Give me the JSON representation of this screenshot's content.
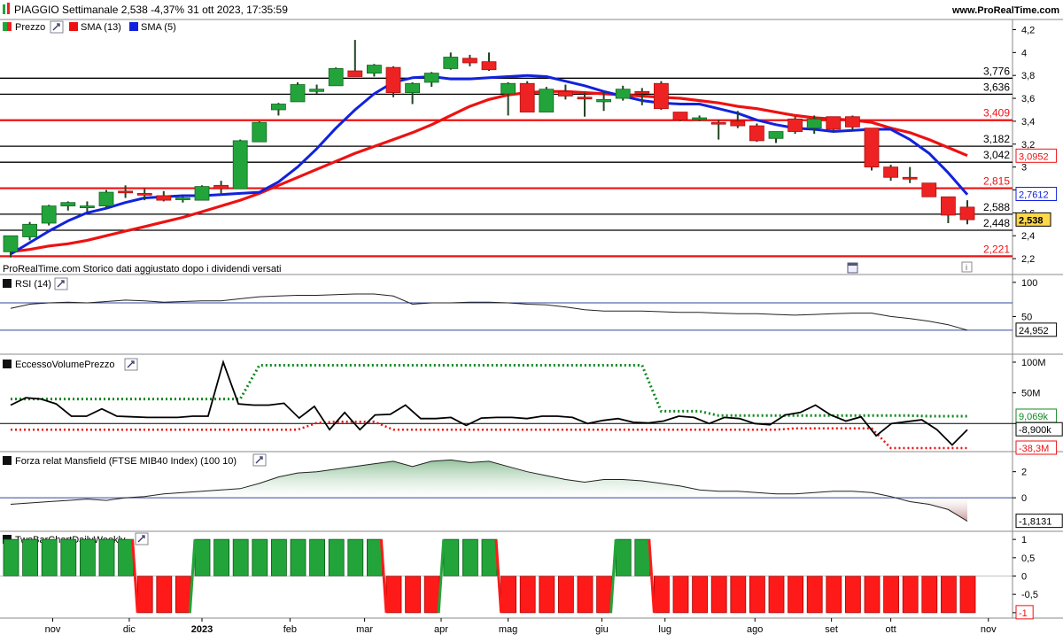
{
  "header": {
    "title": "PIAGGIO Settimanale 2,538 -4,37% 31 ott 2023, 17:35:59",
    "site": "www.ProRealTime.com"
  },
  "panels": {
    "price": {
      "legend": [
        "Prezzo",
        "SMA (13)",
        "SMA (5)"
      ],
      "footer": "ProRealTime.com Storico dati aggiustato dopo i dividendi versati"
    },
    "rsi": {
      "title": "RSI (14)"
    },
    "volume": {
      "title": "EccessoVolumePrezzo"
    },
    "mansfield": {
      "title": "Forza relat Mansfield (FTSE MIB40 Index) (100 10)"
    },
    "twobar": {
      "title": "TwoBarChartDailyWeekly"
    }
  },
  "colors": {
    "up": "#22a43a",
    "down": "#ee2222",
    "sma13": "#ee1111",
    "sma5": "#1122dd",
    "grid": "#000000",
    "green_dotted": "#118822",
    "red_dotted": "#ee1111"
  },
  "chart_data": [
    {
      "type": "candlestick",
      "name": "Prezzo",
      "y_ticks": [
        "4,2",
        "4",
        "3,8",
        "3,6",
        "3,4",
        "3,2",
        "3",
        "2,8",
        "2,6",
        "2,4",
        "2,2"
      ],
      "ylim": [
        2.1,
        4.25
      ],
      "x_labels": [
        "nov",
        "dic",
        "2023",
        "feb",
        "mar",
        "apr",
        "mag",
        "giu",
        "lug",
        "ago",
        "set",
        "ott",
        "nov"
      ],
      "candles": [
        {
          "o": 2.26,
          "h": 2.4,
          "l": 2.21,
          "c": 2.4
        },
        {
          "o": 2.39,
          "h": 2.52,
          "l": 2.36,
          "c": 2.5
        },
        {
          "o": 2.51,
          "h": 2.67,
          "l": 2.49,
          "c": 2.66
        },
        {
          "o": 2.66,
          "h": 2.7,
          "l": 2.62,
          "c": 2.69
        },
        {
          "o": 2.65,
          "h": 2.7,
          "l": 2.61,
          "c": 2.66
        },
        {
          "o": 2.66,
          "h": 2.8,
          "l": 2.64,
          "c": 2.78
        },
        {
          "o": 2.79,
          "h": 2.84,
          "l": 2.73,
          "c": 2.78
        },
        {
          "o": 2.77,
          "h": 2.81,
          "l": 2.71,
          "c": 2.76
        },
        {
          "o": 2.75,
          "h": 2.79,
          "l": 2.7,
          "c": 2.71
        },
        {
          "o": 2.72,
          "h": 2.74,
          "l": 2.69,
          "c": 2.73
        },
        {
          "o": 2.71,
          "h": 2.84,
          "l": 2.71,
          "c": 2.83
        },
        {
          "o": 2.84,
          "h": 2.88,
          "l": 2.77,
          "c": 2.81
        },
        {
          "o": 2.81,
          "h": 3.24,
          "l": 2.81,
          "c": 3.23
        },
        {
          "o": 3.22,
          "h": 3.4,
          "l": 3.22,
          "c": 3.39
        },
        {
          "o": 3.5,
          "h": 3.56,
          "l": 3.45,
          "c": 3.55
        },
        {
          "o": 3.57,
          "h": 3.74,
          "l": 3.57,
          "c": 3.72
        },
        {
          "o": 3.66,
          "h": 3.72,
          "l": 3.64,
          "c": 3.68
        },
        {
          "o": 3.71,
          "h": 3.87,
          "l": 3.71,
          "c": 3.86
        },
        {
          "o": 3.84,
          "h": 4.11,
          "l": 3.79,
          "c": 3.79
        },
        {
          "o": 3.82,
          "h": 3.9,
          "l": 3.79,
          "c": 3.89
        },
        {
          "o": 3.87,
          "h": 3.88,
          "l": 3.61,
          "c": 3.65
        },
        {
          "o": 3.65,
          "h": 3.74,
          "l": 3.55,
          "c": 3.73
        },
        {
          "o": 3.74,
          "h": 3.83,
          "l": 3.7,
          "c": 3.82
        },
        {
          "o": 3.86,
          "h": 4.0,
          "l": 3.85,
          "c": 3.96
        },
        {
          "o": 3.95,
          "h": 3.98,
          "l": 3.88,
          "c": 3.91
        },
        {
          "o": 3.92,
          "h": 4.0,
          "l": 3.84,
          "c": 3.85
        },
        {
          "o": 3.64,
          "h": 3.74,
          "l": 3.45,
          "c": 3.73
        },
        {
          "o": 3.73,
          "h": 3.75,
          "l": 3.48,
          "c": 3.48
        },
        {
          "o": 3.48,
          "h": 3.7,
          "l": 3.48,
          "c": 3.68
        },
        {
          "o": 3.66,
          "h": 3.72,
          "l": 3.59,
          "c": 3.62
        },
        {
          "o": 3.61,
          "h": 3.65,
          "l": 3.44,
          "c": 3.6
        },
        {
          "o": 3.57,
          "h": 3.66,
          "l": 3.49,
          "c": 3.59
        },
        {
          "o": 3.6,
          "h": 3.71,
          "l": 3.58,
          "c": 3.68
        },
        {
          "o": 3.66,
          "h": 3.69,
          "l": 3.54,
          "c": 3.65
        },
        {
          "o": 3.73,
          "h": 3.75,
          "l": 3.5,
          "c": 3.51
        },
        {
          "o": 3.48,
          "h": 3.48,
          "l": 3.4,
          "c": 3.41
        },
        {
          "o": 3.42,
          "h": 3.45,
          "l": 3.4,
          "c": 3.43
        },
        {
          "o": 3.39,
          "h": 3.41,
          "l": 3.24,
          "c": 3.38
        },
        {
          "o": 3.4,
          "h": 3.49,
          "l": 3.34,
          "c": 3.36
        },
        {
          "o": 3.36,
          "h": 3.38,
          "l": 3.22,
          "c": 3.23
        },
        {
          "o": 3.25,
          "h": 3.31,
          "l": 3.21,
          "c": 3.31
        },
        {
          "o": 3.42,
          "h": 3.44,
          "l": 3.29,
          "c": 3.31
        },
        {
          "o": 3.34,
          "h": 3.45,
          "l": 3.29,
          "c": 3.42
        },
        {
          "o": 3.44,
          "h": 3.44,
          "l": 3.3,
          "c": 3.33
        },
        {
          "o": 3.44,
          "h": 3.45,
          "l": 3.32,
          "c": 3.35
        },
        {
          "o": 3.34,
          "h": 3.34,
          "l": 2.97,
          "c": 3.0
        },
        {
          "o": 3.0,
          "h": 3.02,
          "l": 2.88,
          "c": 2.91
        },
        {
          "o": 2.91,
          "h": 3.0,
          "l": 2.86,
          "c": 2.9
        },
        {
          "o": 2.86,
          "h": 2.86,
          "l": 2.74,
          "c": 2.74
        },
        {
          "o": 2.74,
          "h": 2.74,
          "l": 2.51,
          "c": 2.58
        },
        {
          "o": 2.65,
          "h": 2.71,
          "l": 2.5,
          "c": 2.54
        }
      ],
      "sma13": [
        2.26,
        2.28,
        2.31,
        2.33,
        2.36,
        2.4,
        2.44,
        2.48,
        2.52,
        2.56,
        2.61,
        2.66,
        2.71,
        2.77,
        2.84,
        2.91,
        2.98,
        3.05,
        3.12,
        3.18,
        3.24,
        3.3,
        3.37,
        3.45,
        3.53,
        3.59,
        3.63,
        3.65,
        3.66,
        3.66,
        3.65,
        3.64,
        3.63,
        3.62,
        3.61,
        3.6,
        3.58,
        3.56,
        3.53,
        3.51,
        3.48,
        3.45,
        3.43,
        3.42,
        3.41,
        3.39,
        3.34,
        3.3,
        3.24,
        3.17,
        3.1
      ],
      "sma5": [
        2.24,
        2.34,
        2.44,
        2.53,
        2.6,
        2.64,
        2.69,
        2.73,
        2.74,
        2.75,
        2.75,
        2.76,
        2.77,
        2.78,
        2.87,
        3.0,
        3.16,
        3.34,
        3.5,
        3.64,
        3.74,
        3.78,
        3.79,
        3.77,
        3.77,
        3.78,
        3.79,
        3.8,
        3.79,
        3.75,
        3.71,
        3.66,
        3.62,
        3.58,
        3.56,
        3.55,
        3.55,
        3.51,
        3.47,
        3.41,
        3.37,
        3.34,
        3.33,
        3.31,
        3.32,
        3.33,
        3.33,
        3.24,
        3.12,
        2.95,
        2.76
      ],
      "levels": [
        {
          "value": 3.776,
          "label": "3,776",
          "color": "#000000"
        },
        {
          "value": 3.636,
          "label": "3,636",
          "color": "#000000"
        },
        {
          "value": 3.409,
          "label": "3,409",
          "color": "#ee1111"
        },
        {
          "value": 3.182,
          "label": "3,182",
          "color": "#000000"
        },
        {
          "value": 3.042,
          "label": "3,042",
          "color": "#000000"
        },
        {
          "value": 2.815,
          "label": "2,815",
          "color": "#ee1111"
        },
        {
          "value": 2.588,
          "label": "2,588",
          "color": "#000000"
        },
        {
          "value": 2.448,
          "label": "2,448",
          "color": "#000000"
        },
        {
          "value": 2.221,
          "label": "2,221",
          "color": "#ee1111"
        }
      ],
      "last_value_boxes": [
        {
          "value": 3.0952,
          "label": "3,0952",
          "color": "#ee1111"
        },
        {
          "value": 2.7612,
          "label": "2,7612",
          "color": "#1122dd"
        },
        {
          "value": 2.538,
          "label": "2,538",
          "color": "#000000"
        }
      ]
    },
    {
      "type": "line",
      "name": "RSI (14)",
      "y_ticks": [
        "100",
        "50"
      ],
      "ylim": [
        0,
        105
      ],
      "bands": [
        70,
        30
      ],
      "values": [
        62,
        68,
        70,
        71,
        70,
        72,
        74,
        73,
        71,
        72,
        73,
        73,
        76,
        79,
        80,
        81,
        81,
        82,
        83,
        83,
        80,
        68,
        70,
        70,
        71,
        71,
        70,
        68,
        67,
        64,
        60,
        58,
        58,
        58,
        57,
        56,
        56,
        55,
        54,
        54,
        53,
        52,
        53,
        54,
        55,
        55,
        50,
        47,
        43,
        38,
        30
      ],
      "last_label": "24,952"
    },
    {
      "type": "line",
      "name": "EccessoVolumePrezzo",
      "y_ticks": [
        "100M",
        "50M",
        "0"
      ],
      "ylim": [
        -40,
        100
      ],
      "values": [
        30,
        42,
        40,
        32,
        12,
        12,
        24,
        12,
        11,
        10,
        10,
        10,
        12,
        12,
        100,
        32,
        30,
        30,
        33,
        9,
        28,
        -10,
        18,
        -10,
        14,
        15,
        30,
        8,
        8,
        10,
        -3,
        9,
        10,
        10,
        8,
        12,
        12,
        10,
        0,
        5,
        8,
        2,
        1,
        4,
        12,
        10,
        0,
        10,
        8,
        0,
        -2,
        14,
        18,
        30,
        14,
        4,
        11,
        -20,
        0,
        3,
        6,
        -10,
        -35,
        -10
      ],
      "dotted_upper": [
        40,
        40,
        40,
        40,
        40,
        40,
        40,
        40,
        40,
        40,
        40,
        40,
        40,
        95,
        95,
        95,
        95,
        95,
        95,
        95,
        95,
        95,
        95,
        95,
        95,
        95,
        95,
        95,
        95,
        95,
        95,
        95,
        95,
        95,
        20,
        20,
        20,
        13,
        13,
        13,
        13,
        13,
        13,
        13,
        13,
        13,
        13,
        13,
        12,
        12,
        12
      ],
      "dotted_lower": [
        -10,
        -10,
        -10,
        -10,
        -10,
        -10,
        -10,
        -10,
        -10,
        -10,
        -10,
        -10,
        -10,
        -10,
        -10,
        -10,
        1,
        3,
        3,
        3,
        -10,
        -10,
        -10,
        -10,
        -10,
        -10,
        -10,
        -10,
        -10,
        -10,
        -10,
        -10,
        -10,
        -10,
        -10,
        -10,
        -10,
        -10,
        -10,
        -10,
        -10,
        -8,
        -8,
        -8,
        -8,
        -8,
        -40,
        -40,
        -40,
        -40,
        -40
      ],
      "last_labels": [
        {
          "label": "9,069k",
          "color": "#118822"
        },
        {
          "label": "-8,900k",
          "color": "#000000"
        },
        {
          "label": "-38,3M",
          "color": "#ee1111"
        }
      ]
    },
    {
      "type": "area",
      "name": "Forza relat Mansfield (FTSE MIB40 Index) (100 10)",
      "y_ticks": [
        "2",
        "0"
      ],
      "ylim": [
        -2.3,
        3.2
      ],
      "values": [
        -0.5,
        -0.4,
        -0.3,
        -0.2,
        -0.1,
        -0.2,
        0.0,
        0.1,
        0.3,
        0.4,
        0.5,
        0.6,
        0.7,
        1.1,
        1.6,
        1.9,
        2.0,
        2.2,
        2.4,
        2.6,
        2.8,
        2.4,
        2.8,
        2.9,
        2.7,
        2.8,
        2.4,
        2.0,
        1.7,
        1.4,
        1.2,
        1.4,
        1.4,
        1.3,
        1.1,
        0.9,
        0.6,
        0.5,
        0.5,
        0.4,
        0.3,
        0.3,
        0.4,
        0.5,
        0.5,
        0.4,
        0.1,
        -0.3,
        -0.5,
        -0.9,
        -1.8
      ],
      "last_label": "-1,8131"
    },
    {
      "type": "bar",
      "name": "TwoBarChartDailyWeekly",
      "y_ticks": [
        "1",
        "0,5",
        "0",
        "-0,5",
        "-1"
      ],
      "ylim": [
        -1.1,
        1.1
      ],
      "values": [
        1,
        1,
        1,
        1,
        1,
        1,
        1,
        -1,
        -1,
        -1,
        1,
        1,
        1,
        1,
        1,
        1,
        1,
        1,
        1,
        1,
        -1,
        -1,
        -1,
        1,
        1,
        1,
        -1,
        -1,
        -1,
        -1,
        -1,
        -1,
        1,
        1,
        -1,
        -1,
        -1,
        -1,
        -1,
        -1,
        -1,
        -1,
        -1,
        -1,
        -1,
        -1,
        -1,
        -1,
        -1,
        -1,
        -1,
        -1
      ],
      "last_label": "-1"
    }
  ]
}
